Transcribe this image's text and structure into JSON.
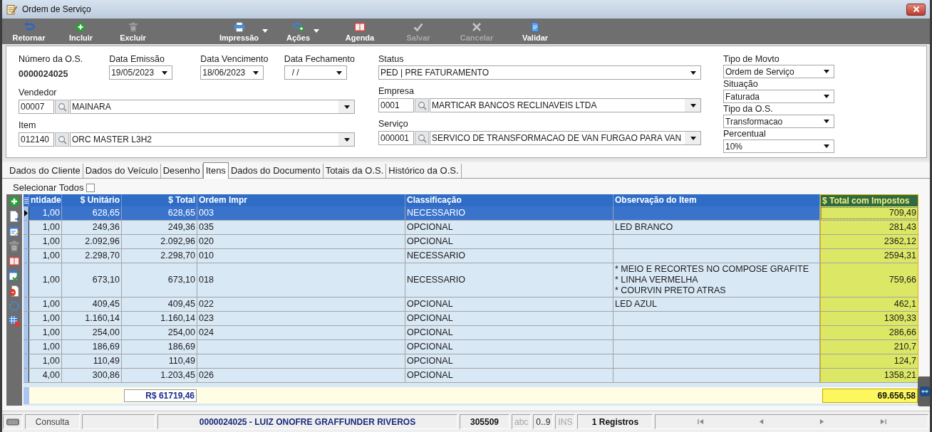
{
  "window": {
    "title": "Ordem de Serviço"
  },
  "toolbar": {
    "groups": [
      [
        {
          "label": "Retornar",
          "kind": "return",
          "disabled": false,
          "dropdown": false
        },
        {
          "label": "Incluir",
          "kind": "add",
          "disabled": false,
          "dropdown": false
        },
        {
          "label": "Excluir",
          "kind": "delete",
          "disabled": false,
          "dropdown": false
        }
      ],
      [
        {
          "label": "Impressão",
          "kind": "print",
          "disabled": false,
          "dropdown": true
        },
        {
          "label": "Ações",
          "kind": "actions",
          "disabled": false,
          "dropdown": true
        },
        {
          "label": "Agenda",
          "kind": "calendar",
          "disabled": false,
          "dropdown": false
        },
        {
          "label": "Salvar",
          "kind": "save",
          "disabled": true,
          "dropdown": false
        },
        {
          "label": "Cancelar",
          "kind": "cancel",
          "disabled": true,
          "dropdown": false
        },
        {
          "label": "Validar",
          "kind": "validate",
          "disabled": false,
          "dropdown": false
        }
      ]
    ]
  },
  "form": {
    "numero": {
      "label": "Número da O.S.",
      "value": "0000024025"
    },
    "dates": [
      {
        "label": "Data Emissão",
        "value": "19/05/2023"
      },
      {
        "label": "Data Vencimento",
        "value": "18/06/2023"
      },
      {
        "label": "Data Fechamento",
        "value": "/ /"
      }
    ],
    "vendedor": {
      "label": "Vendedor",
      "code": "00007",
      "value": "MAINARA"
    },
    "item": {
      "label": "Item",
      "code": "012140",
      "value": "ORC MASTER L3H2"
    },
    "status": {
      "label": "Status",
      "value": "PED | PRE FATURAMENTO"
    },
    "empresa": {
      "label": "Empresa",
      "code": "0001",
      "value": "MARTICAR BANCOS RECLINAVEIS LTDA"
    },
    "servico": {
      "label": "Serviço",
      "code": "000001",
      "value": "SERVICO DE TRANSFORMACAO DE VAN FURGAO PARA VAN"
    },
    "side": [
      {
        "label": "Tipo de Movto",
        "value": "Ordem de Serviço"
      },
      {
        "label": "Situação",
        "value": "Faturada"
      },
      {
        "label": "Tipo da O.S.",
        "value": "Transformacao"
      },
      {
        "label": "Percentual",
        "value": "10%"
      }
    ]
  },
  "tabs": [
    {
      "label": "Dados do Cliente",
      "selected": false
    },
    {
      "label": "Dados do Veículo",
      "selected": false
    },
    {
      "label": "Desenho",
      "selected": false
    },
    {
      "label": "Itens",
      "selected": true
    },
    {
      "label": "Dados do Documento",
      "selected": false
    },
    {
      "label": "Totais da O.S.",
      "selected": false
    },
    {
      "label": "Histórico da O.S.",
      "selected": false
    }
  ],
  "select_all": {
    "label": "Selecionar Todos",
    "checked": false
  },
  "grid": {
    "columns": [
      {
        "label": "ntidade",
        "kind": "number"
      },
      {
        "label": "$ Unitário",
        "kind": "number"
      },
      {
        "label": "$ Total",
        "kind": "number"
      },
      {
        "label": "Ordem Impr",
        "kind": "text"
      },
      {
        "label": "Classificação",
        "kind": "text"
      },
      {
        "label": "Observação do Item",
        "kind": "text"
      },
      {
        "label": "$ Total com Impostos",
        "kind": "highlight"
      }
    ],
    "rows": [
      {
        "selected": true,
        "column_1": "1,00",
        "unitario": "628,65",
        "total": "628,65",
        "ordem_impr": "003",
        "classificacao": "NECESSARIO",
        "total_com_impostos": "709,49"
      },
      {
        "selected": false,
        "column_1": "1,00",
        "unitario": "249,36",
        "total": "249,36",
        "ordem_impr": "035",
        "classificacao": "OPCIONAL",
        "observacao": "LED BRANCO",
        "total_com_impostos": "281,43"
      },
      {
        "selected": false,
        "column_1": "1,00",
        "unitario": "2.092,96",
        "total": "2.092,96",
        "ordem_impr": "020",
        "classificacao": "OPCIONAL",
        "total_com_impostos": "2362,12"
      },
      {
        "selected": false,
        "column_1": "1,00",
        "unitario": "2.298,70",
        "total": "2.298,70",
        "ordem_impr": "010",
        "classificacao": "NECESSARIO",
        "total_com_impostos": "2594,31"
      },
      {
        "selected": false,
        "column_1": "1,00",
        "unitario": "673,10",
        "total": "673,10",
        "ordem_impr": "018",
        "classificacao": "NECESSARIO",
        "observacao": "* MEIO E RECORTES NO COMPOSE GRAFITE\n* LINHA VERMELHA\n* COURVIN PRETO ATRAS",
        "total_com_impostos": "759,66"
      },
      {
        "selected": false,
        "column_1": "1,00",
        "unitario": "409,45",
        "total": "409,45",
        "ordem_impr": "022",
        "classificacao": "OPCIONAL",
        "observacao": "LED AZUL",
        "total_com_impostos": "462,1"
      },
      {
        "selected": false,
        "column_1": "1,00",
        "unitario": "1.160,14",
        "total": "1.160,14",
        "ordem_impr": "023",
        "classificacao": "OPCIONAL",
        "total_com_impostos": "1309,33"
      },
      {
        "selected": false,
        "column_1": "1,00",
        "unitario": "254,00",
        "total": "254,00",
        "ordem_impr": "024",
        "classificacao": "OPCIONAL",
        "total_com_impostos": "286,66"
      },
      {
        "selected": false,
        "column_1": "1,00",
        "unitario": "186,69",
        "total": "186,69",
        "classificacao": "OPCIONAL",
        "total_com_impostos": "210,7"
      },
      {
        "selected": false,
        "column_1": "1,00",
        "unitario": "110,49",
        "total": "110,49",
        "classificacao": "OPCIONAL",
        "total_com_impostos": "124,7"
      },
      {
        "selected": false,
        "column_1": "4,00",
        "unitario": "300,86",
        "total": "1.203,45",
        "ordem_impr": "026",
        "classificacao": "OPCIONAL",
        "total_com_impostos": "1358,21"
      }
    ],
    "totals": {
      "total": "R$ 61719,46",
      "total_com_impostos": "69.656,58"
    }
  },
  "status_bar": {
    "mode": "Consulta",
    "record": "0000024025 - LUIZ ONOFRE GRAFFUNDER RIVEROS",
    "code": "305509",
    "indicators": [
      {
        "label": "abc",
        "on": false
      },
      {
        "label": "0..9",
        "on": true
      },
      {
        "label": "INS",
        "on": false
      }
    ],
    "count": "1 Registros"
  }
}
